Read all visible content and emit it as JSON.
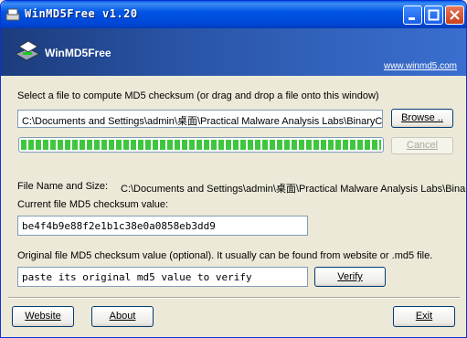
{
  "window": {
    "title": "WinMD5Free v1.20"
  },
  "banner": {
    "brand": "WinMD5Free",
    "link": "www.winmd5.com"
  },
  "select_file": {
    "label": "Select a file to compute MD5 checksum (or drag and drop a file onto this window)",
    "path_value": "C:\\Documents and Settings\\admin\\桌面\\Practical Malware Analysis Labs\\BinaryColl",
    "browse_label": "Browse .."
  },
  "progress": {
    "percent": 100,
    "cancel_label": "Cancel"
  },
  "file_info": {
    "label": "File Name and Size:",
    "value": "C:\\Documents and Settings\\admin\\桌面\\Practical Malware Analysis Labs\\Binary"
  },
  "current_md5": {
    "label": "Current file MD5 checksum value:",
    "value": "be4f4b9e88f2e1b1c38e0a0858eb3dd9"
  },
  "original_md5": {
    "label": "Original file MD5 checksum value (optional). It usually can be found from website or .md5 file.",
    "value": "paste its original md5 value to verify",
    "verify_label": "Verify"
  },
  "footer": {
    "website_label": "Website",
    "about_label": "About",
    "exit_label": "Exit"
  },
  "colors": {
    "title_bar": "#0054e3",
    "banner": "#2a55a8",
    "progress": "#3fc63f",
    "background": "#ece9d8"
  }
}
